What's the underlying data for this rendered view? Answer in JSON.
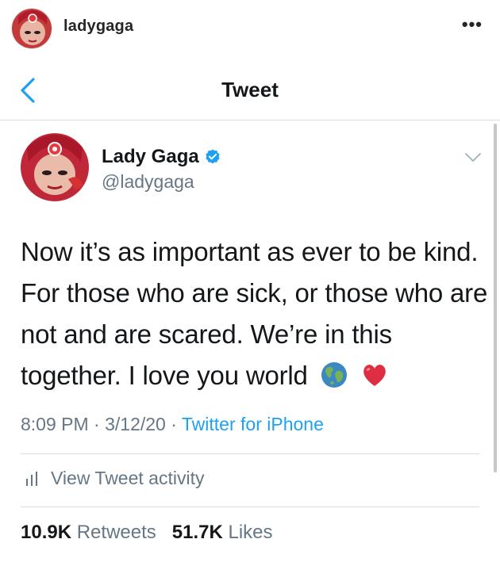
{
  "instagram": {
    "username": "ladygaga",
    "more_label": "•••"
  },
  "nav": {
    "title": "Tweet"
  },
  "tweet": {
    "display_name": "Lady Gaga",
    "handle": "@ladygaga",
    "text": "Now it’s as important as ever to be kind. For those who are sick, or those who are not and are scared. We’re in this together. I love you world",
    "emojis": [
      "globe-icon",
      "red-heart-icon"
    ],
    "time": "8:09 PM",
    "date": "3/12/20",
    "separator": "·",
    "source": "Twitter for iPhone",
    "activity_label": "View Tweet activity",
    "retweets_count": "10.9K",
    "retweets_label": "Retweets",
    "likes_count": "51.7K",
    "likes_label": "Likes"
  },
  "colors": {
    "twitter_blue": "#1da1f2",
    "secondary_text": "#657786",
    "primary_text": "#14171a",
    "divider": "#d8dde1"
  }
}
